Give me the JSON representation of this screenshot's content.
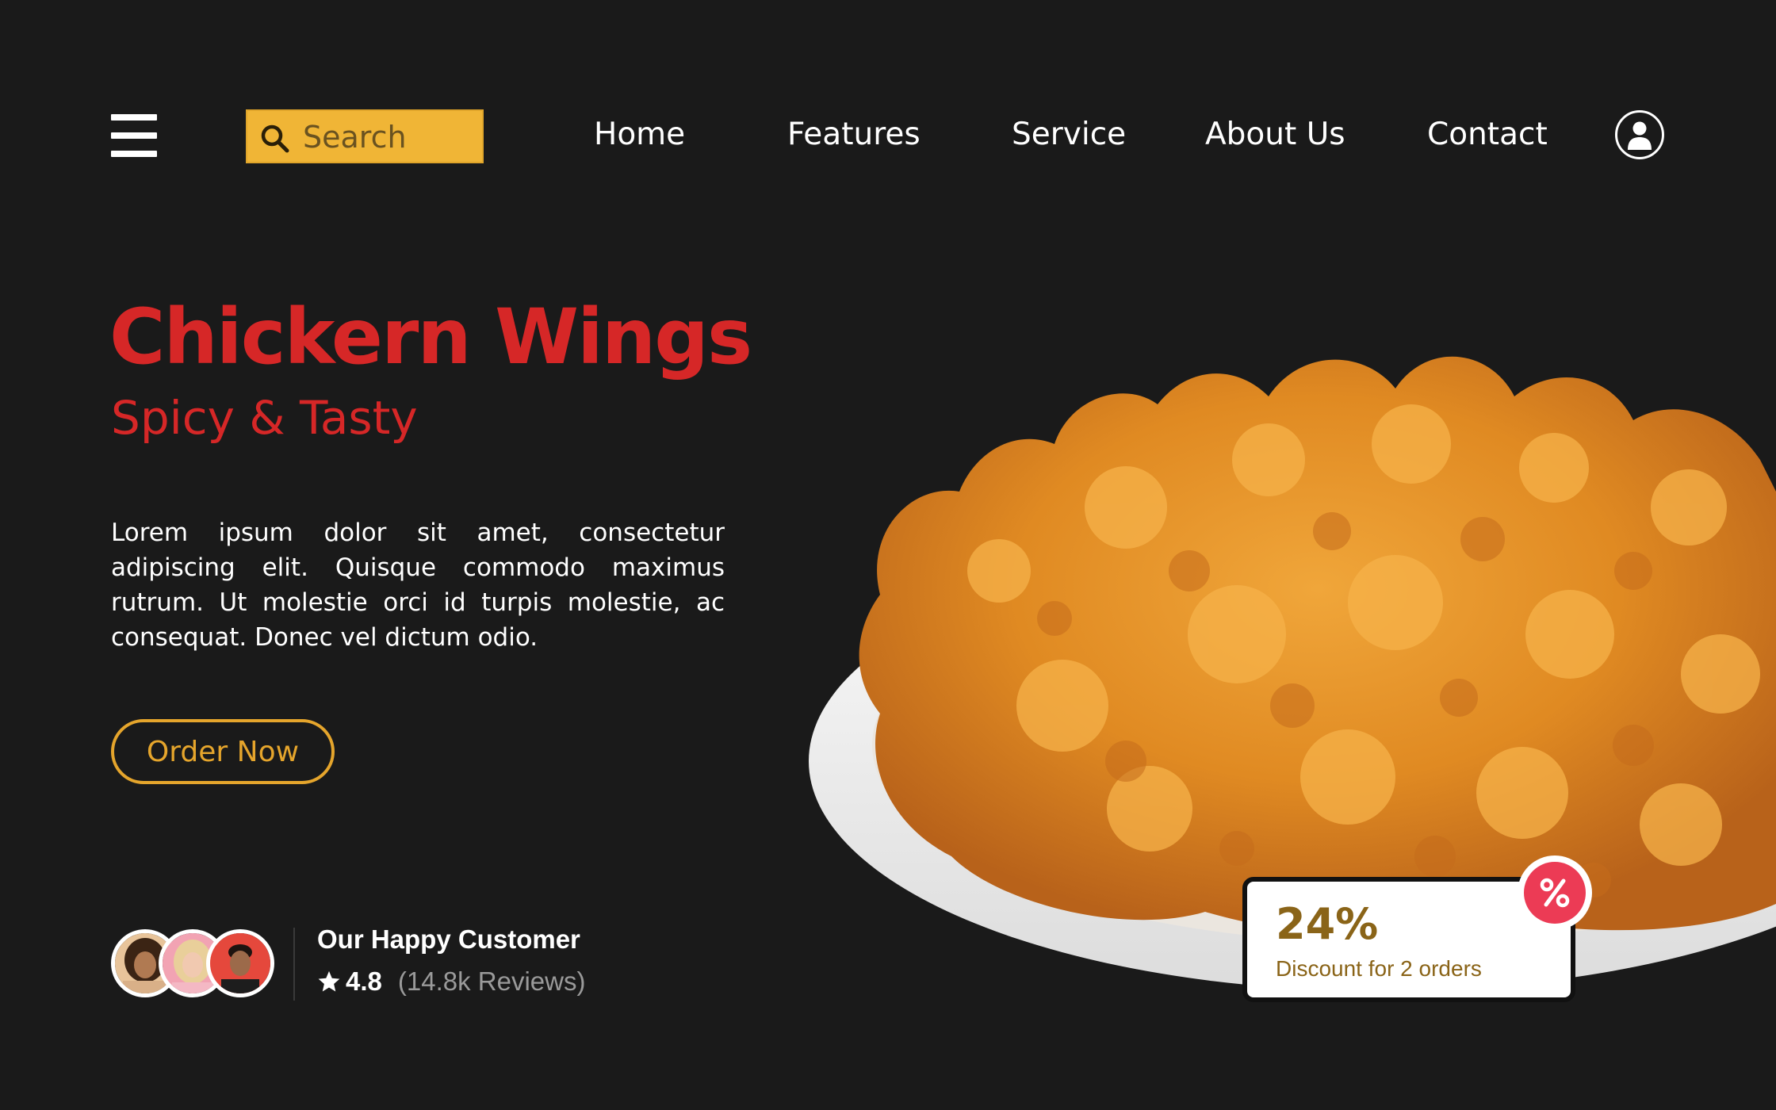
{
  "nav": {
    "search_placeholder": "Search",
    "links": [
      "Home",
      "Features",
      "Service",
      "About Us",
      "Contact"
    ]
  },
  "hero": {
    "title": "Chickern Wings",
    "subtitle": "Spicy & Tasty",
    "description": "Lorem ipsum dolor sit amet, consectetur adipiscing elit. Quisque commodo maximus rutrum. Ut molestie orci id turpis molestie, ac consequat. Donec vel dictum odio.",
    "cta_label": "Order Now"
  },
  "customers": {
    "title": "Our Happy Customer",
    "rating": "4.8",
    "reviews": "(14.8k Reviews)"
  },
  "discount": {
    "percent": "24%",
    "label": "Discount for 2 orders"
  },
  "colors": {
    "background": "#1a1a1a",
    "accent_red": "#d62727",
    "accent_yellow": "#f0b536",
    "badge_pink": "#ec3b55",
    "discount_text": "#8a6418"
  },
  "icons": {
    "menu": "hamburger-icon",
    "search": "search-icon",
    "user": "user-icon",
    "star": "star-icon",
    "discount": "percent-icon"
  }
}
